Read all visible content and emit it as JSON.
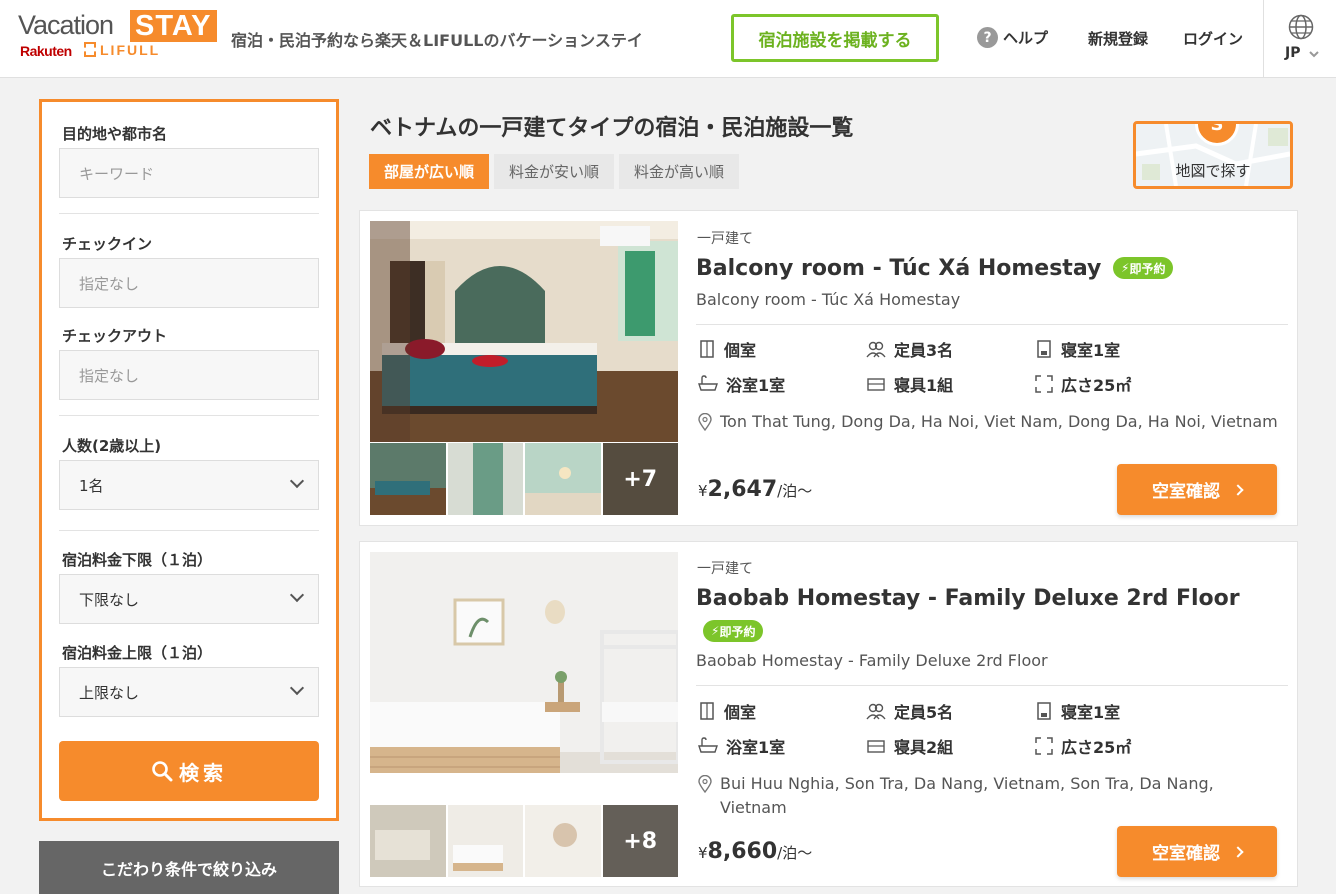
{
  "header": {
    "logo": {
      "vacation": "Vacation",
      "stay": "STAY",
      "rakuten": "Rakuten",
      "lifull": "LIFULL"
    },
    "tagline": "宿泊・民泊予約なら楽天＆LIFULLのバケーションステイ",
    "list_property_label": "宿泊施設を掲載する",
    "help_label": "ヘルプ",
    "register_label": "新規登録",
    "login_label": "ログイン",
    "language": "JP"
  },
  "sidebar": {
    "destination": {
      "label": "目的地や都市名",
      "placeholder": "キーワード"
    },
    "checkin": {
      "label": "チェックイン",
      "placeholder": "指定なし"
    },
    "checkout": {
      "label": "チェックアウト",
      "placeholder": "指定なし"
    },
    "guests": {
      "label": "人数(2歳以上)",
      "value": "1名"
    },
    "price_min": {
      "label": "宿泊料金下限（１泊）",
      "value": "下限なし"
    },
    "price_max": {
      "label": "宿泊料金上限（１泊）",
      "value": "上限なし"
    },
    "search_label": "検索",
    "refine_label": "こだわり条件で絞り込み"
  },
  "main": {
    "title": "ベトナムの一戸建てタイプの宿泊・民泊施設一覧",
    "sort_tabs": [
      {
        "label": "部屋が広い順",
        "active": true
      },
      {
        "label": "料金が安い順",
        "active": false
      },
      {
        "label": "料金が高い順",
        "active": false
      }
    ],
    "map_label": "地図で探す",
    "map_pin": "S"
  },
  "listings": [
    {
      "type": "一戸建て",
      "name": "Balcony room - Túc Xá Homestay",
      "badge": "即予約",
      "subtitle": "Balcony room - Túc Xá Homestay",
      "specs": {
        "room": "個室",
        "capacity": "定員3名",
        "bedrooms": "寝室1室",
        "bathrooms": "浴室1室",
        "beds": "寝具1組",
        "area": "広さ25㎡"
      },
      "address": "Ton That Tung, Dong Da, Ha Noi, Viet Nam, Dong Da, Ha Noi, Vietnam",
      "price_currency": "¥",
      "price": "2,647",
      "price_unit": "/泊～",
      "more_photos": "+7",
      "book_label": "空室確認"
    },
    {
      "type": "一戸建て",
      "name": "Baobab Homestay - Family Deluxe 2rd Floor",
      "badge": "即予約",
      "subtitle": "Baobab Homestay - Family Deluxe 2rd Floor",
      "specs": {
        "room": "個室",
        "capacity": "定員5名",
        "bedrooms": "寝室1室",
        "bathrooms": "浴室1室",
        "beds": "寝具2組",
        "area": "広さ25㎡"
      },
      "address": "Bui Huu Nghia, Son Tra, Da Nang, Vietnam, Son Tra, Da Nang, Vietnam",
      "price_currency": "¥",
      "price": "8,660",
      "price_unit": "/泊～",
      "more_photos": "+8",
      "book_label": "空室確認"
    }
  ],
  "colors": {
    "accent": "#f68b2c",
    "badge_green": "#7cc52a",
    "rakuten_red": "#bf0000"
  }
}
